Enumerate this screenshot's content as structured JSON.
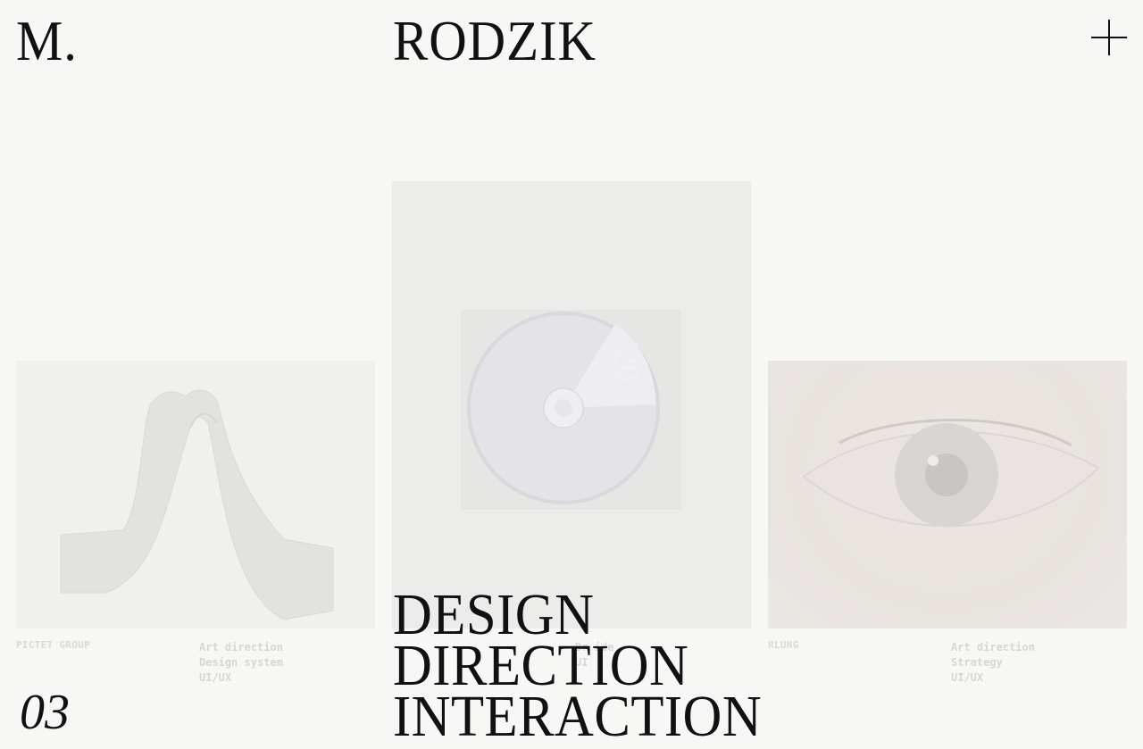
{
  "header": {
    "logo_initial": "M.",
    "logo_name": "RODZIK",
    "menu_icon": "plus-icon"
  },
  "projects": [
    {
      "client": "PICTET GROUP",
      "services": [
        "Art direction",
        "Design system",
        "UI/UX"
      ],
      "image_icon": "sculpture-image"
    },
    {
      "client": "",
      "services": [
        "",
        "Br  ide",
        "UI"
      ],
      "image_icon": "cd-album-image"
    },
    {
      "client": "RLUNG",
      "services": [
        "Art direction",
        "Strategy",
        "UI/UX"
      ],
      "image_icon": "eye-closeup-image"
    }
  ],
  "hero": {
    "words": [
      "DESIGN",
      "DIRECTION",
      "INTERACTION"
    ],
    "counter": "03"
  },
  "colors": {
    "background": "#f7f7f5",
    "text": "#111111",
    "muted": "#d6d6d4"
  }
}
